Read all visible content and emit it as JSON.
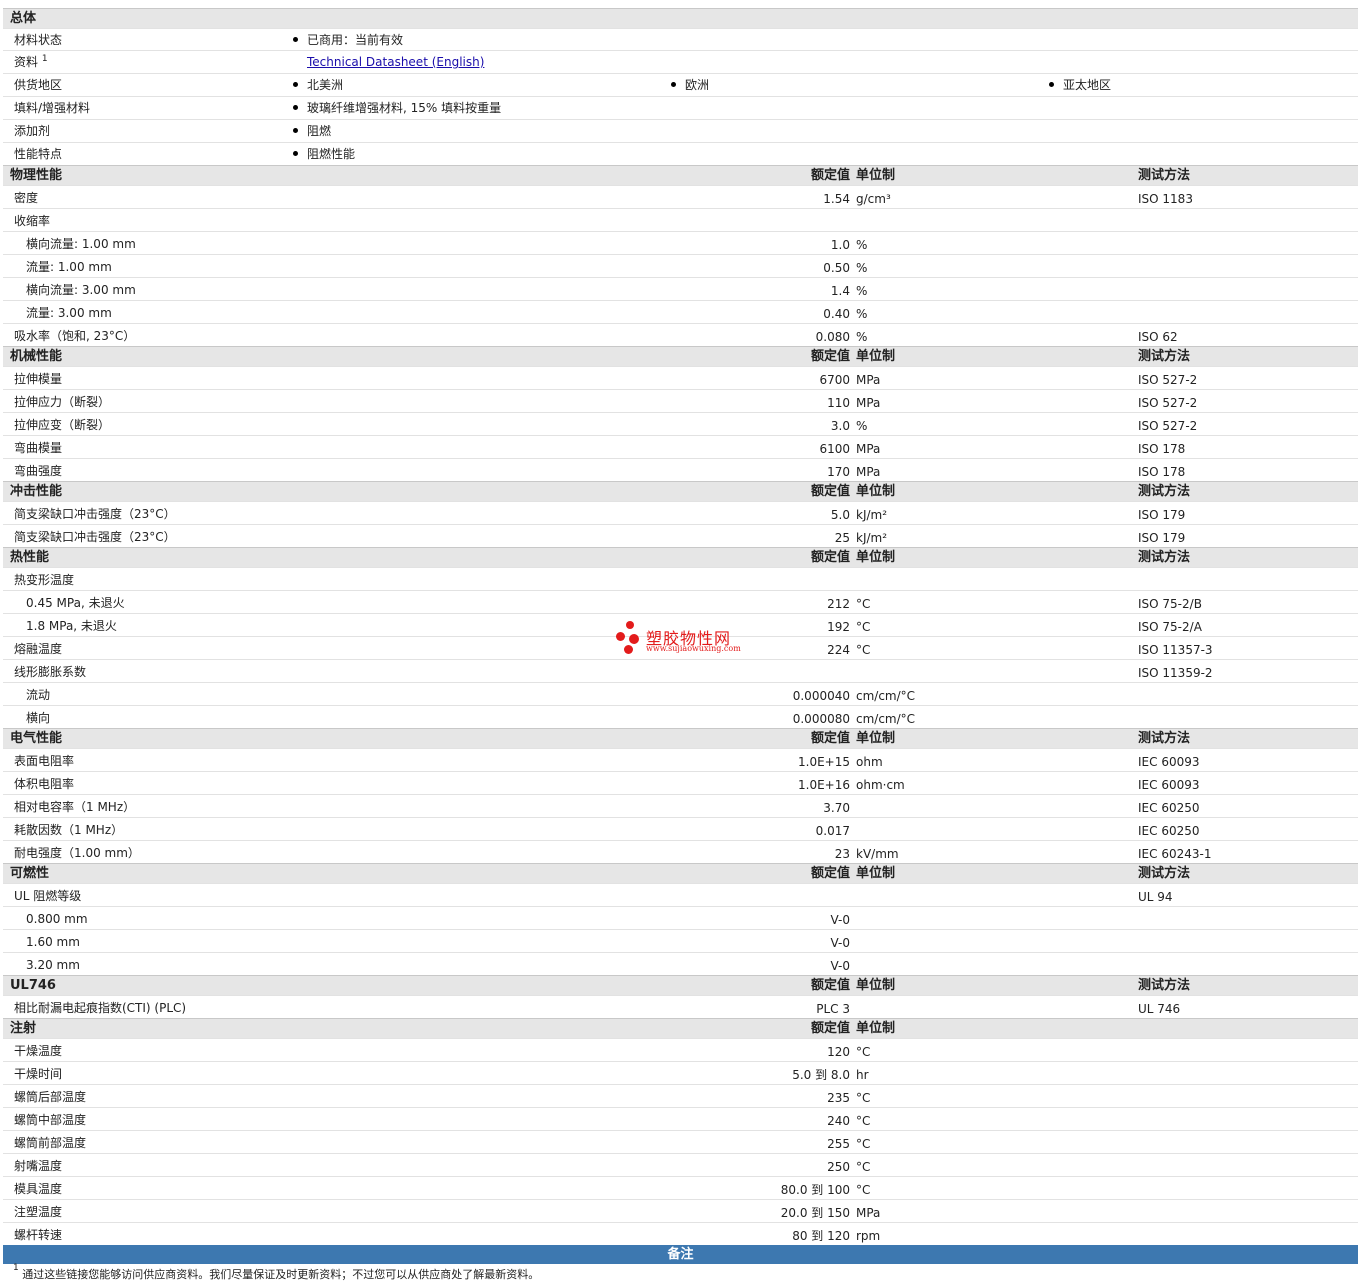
{
  "general": {
    "title": "总体",
    "rows": [
      {
        "label": "材料状态",
        "bullets": [
          "已商用：当前有效"
        ]
      },
      {
        "label": "资料",
        "sup": "1",
        "link": "Technical Datasheet (English)"
      },
      {
        "label": "供货地区",
        "bullets": [
          "北美洲",
          "欧洲",
          "亚太地区"
        ]
      },
      {
        "label": "填料/增强材料",
        "bullets": [
          "玻璃纤维增强材料, 15% 填料按重量"
        ]
      },
      {
        "label": "添加剂",
        "bullets": [
          "阻燃"
        ]
      },
      {
        "label": "性能特点",
        "bullets": [
          "阻燃性能"
        ]
      }
    ]
  },
  "headers": {
    "nominal": "额定值",
    "unit": "单位制",
    "method": "测试方法"
  },
  "physical": {
    "title": "物理性能",
    "rows": [
      {
        "label": "密度",
        "value": "1.54",
        "unit": "g/cm³",
        "method": "ISO 1183"
      },
      {
        "label": "收缩率",
        "value": "",
        "unit": "",
        "method": ""
      },
      {
        "label": "横向流量: 1.00 mm",
        "value": "1.0",
        "unit": "%",
        "method": ""
      },
      {
        "label": "流量: 1.00 mm",
        "value": "0.50",
        "unit": "%",
        "method": ""
      },
      {
        "label": "横向流量: 3.00 mm",
        "value": "1.4",
        "unit": "%",
        "method": ""
      },
      {
        "label": "流量: 3.00 mm",
        "value": "0.40",
        "unit": "%",
        "method": ""
      },
      {
        "label": "吸水率（饱和, 23°C）",
        "value": "0.080",
        "unit": "%",
        "method": "ISO 62"
      }
    ]
  },
  "mechanical": {
    "title": "机械性能",
    "rows": [
      {
        "label": "拉伸模量",
        "value": "6700",
        "unit": "MPa",
        "method": "ISO 527-2"
      },
      {
        "label": "拉伸应力（断裂）",
        "value": "110",
        "unit": "MPa",
        "method": "ISO 527-2"
      },
      {
        "label": "拉伸应变（断裂）",
        "value": "3.0",
        "unit": "%",
        "method": "ISO 527-2"
      },
      {
        "label": "弯曲模量",
        "value": "6100",
        "unit": "MPa",
        "method": "ISO 178"
      },
      {
        "label": "弯曲强度",
        "value": "170",
        "unit": "MPa",
        "method": "ISO 178"
      }
    ]
  },
  "impact": {
    "title": "冲击性能",
    "rows": [
      {
        "label": "简支梁缺口冲击强度（23°C）",
        "value": "5.0",
        "unit": "kJ/m²",
        "method": "ISO 179"
      },
      {
        "label": "简支梁缺口冲击强度（23°C）",
        "value": "25",
        "unit": "kJ/m²",
        "method": "ISO 179"
      }
    ]
  },
  "thermal": {
    "title": "热性能",
    "rows": [
      {
        "label": "热变形温度",
        "value": "",
        "unit": "",
        "method": ""
      },
      {
        "label": "0.45 MPa, 未退火",
        "value": "212",
        "unit": "°C",
        "method": "ISO 75-2/B"
      },
      {
        "label": "1.8 MPa, 未退火",
        "value": "192",
        "unit": "°C",
        "method": "ISO 75-2/A"
      },
      {
        "label": "熔融温度",
        "value": "224",
        "unit": "°C",
        "method": "ISO 11357-3"
      },
      {
        "label": "线形膨胀系数",
        "value": "",
        "unit": "",
        "method": "ISO 11359-2"
      },
      {
        "label": "流动",
        "value": "0.000040",
        "unit": "cm/cm/°C",
        "method": ""
      },
      {
        "label": "横向",
        "value": "0.000080",
        "unit": "cm/cm/°C",
        "method": ""
      }
    ]
  },
  "electrical": {
    "title": "电气性能",
    "rows": [
      {
        "label": "表面电阻率",
        "value": "1.0E+15",
        "unit": "ohm",
        "method": "IEC 60093"
      },
      {
        "label": "体积电阻率",
        "value": "1.0E+16",
        "unit": "ohm·cm",
        "method": "IEC 60093"
      },
      {
        "label": "相对电容率（1 MHz）",
        "value": "3.70",
        "unit": "",
        "method": "IEC 60250"
      },
      {
        "label": "耗散因数（1 MHz）",
        "value": "0.017",
        "unit": "",
        "method": "IEC 60250"
      },
      {
        "label": "耐电强度（1.00 mm）",
        "value": "23",
        "unit": "kV/mm",
        "method": "IEC 60243-1"
      }
    ]
  },
  "flammability": {
    "title": "可燃性",
    "rows": [
      {
        "label": "UL 阻燃等级",
        "value": "",
        "unit": "",
        "method": "UL 94"
      },
      {
        "label": "0.800 mm",
        "value": "V-0",
        "unit": "",
        "method": ""
      },
      {
        "label": "1.60 mm",
        "value": "V-0",
        "unit": "",
        "method": ""
      },
      {
        "label": "3.20 mm",
        "value": "V-0",
        "unit": "",
        "method": ""
      }
    ]
  },
  "ul746": {
    "title": "UL746",
    "rows": [
      {
        "label": "相比耐漏电起痕指数(CTI) (PLC)",
        "value": "PLC 3",
        "unit": "",
        "method": "UL 746"
      }
    ]
  },
  "injection": {
    "title": "注射",
    "rows": [
      {
        "label": "干燥温度",
        "value": "120",
        "unit": "°C"
      },
      {
        "label": "干燥时间",
        "value": "5.0 到  8.0",
        "unit": "hr"
      },
      {
        "label": "螺筒后部温度",
        "value": "235",
        "unit": "°C"
      },
      {
        "label": "螺筒中部温度",
        "value": "240",
        "unit": "°C"
      },
      {
        "label": "螺筒前部温度",
        "value": "255",
        "unit": "°C"
      },
      {
        "label": "射嘴温度",
        "value": "250",
        "unit": "°C"
      },
      {
        "label": "模具温度",
        "value": "80.0 到  100",
        "unit": "°C"
      },
      {
        "label": "注塑温度",
        "value": "20.0 到  150",
        "unit": "MPa"
      },
      {
        "label": "螺杆转速",
        "value": "80 到  120",
        "unit": "rpm"
      }
    ]
  },
  "notes": {
    "title": "备注",
    "footnote_mark": "1",
    "footnote": "通过这些链接您能够访问供应商资料。我们尽量保证及时更新资料；不过您可以从供应商处了解最新资料。"
  },
  "watermark": {
    "name": "塑胶物性网",
    "url": "www.sujiaowuxing.com"
  },
  "colors": {
    "section_bg": "#e6e6e6",
    "notes_bar": "#3d78b0",
    "link": "#1a0dab",
    "watermark": "#e31b1b"
  }
}
